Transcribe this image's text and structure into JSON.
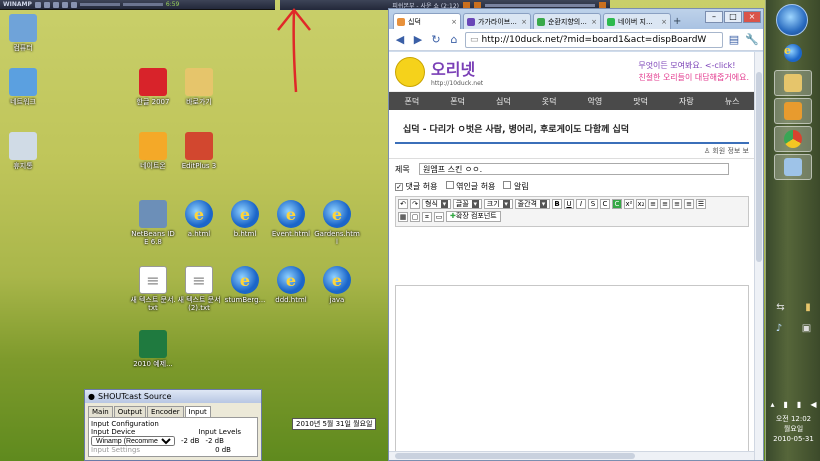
{
  "winamp": {
    "app_label": "WINAMP",
    "time": "6:59",
    "track_title": "피쉬본부 - 사운 쇼 (2:12)"
  },
  "desktop": {
    "icons": [
      {
        "label": "컴퓨터",
        "type": "computer"
      },
      {
        "label": "네트워크",
        "type": "network"
      },
      {
        "label": "휴지통",
        "type": "recycle"
      },
      {
        "label": "한글 2007",
        "type": "hangul"
      },
      {
        "label": "바로가기",
        "type": "folder"
      },
      {
        "label": "네이트온",
        "type": "nateon"
      },
      {
        "label": "EditPlus 3",
        "type": "editplus"
      },
      {
        "label": "NetBeans IDE 6.8",
        "type": "netbeans"
      },
      {
        "label": "a.html",
        "type": "ie"
      },
      {
        "label": "b.html",
        "type": "ie"
      },
      {
        "label": "Event.html",
        "type": "ie"
      },
      {
        "label": "Gardens.html",
        "type": "ie"
      },
      {
        "label": "새 텍스트 문서.txt",
        "type": "txt"
      },
      {
        "label": "새 텍스트 문서 (2).txt",
        "type": "txt"
      },
      {
        "label": "stumBerg...",
        "type": "ie"
      },
      {
        "label": "ddd.html",
        "type": "ie"
      },
      {
        "label": "java",
        "type": "ie"
      },
      {
        "label": "2010 예제...",
        "type": "excel"
      }
    ]
  },
  "shoutcast": {
    "title": "SHOUTcast Source",
    "tabs": [
      "Main",
      "Output",
      "Encoder",
      "Input"
    ],
    "active_tab": "Input",
    "section": "Input Configuration",
    "device_label": "Input Device",
    "device_value": "Winamp (Recommendec",
    "levels_label": "Input Levels",
    "level_left": "-2 dB",
    "level_right": "-2 dB",
    "level_mid": "0 dB",
    "settings_label": "Input Settings"
  },
  "browser": {
    "tabs": [
      {
        "label": "십덕",
        "color": "#e8913b"
      },
      {
        "label": "가가라이브...",
        "color": "#6a47b8"
      },
      {
        "label": "순환지향의...",
        "color": "#39a94a"
      },
      {
        "label": "네이버 지...",
        "color": "#2dba4e"
      }
    ],
    "new_tab": "+",
    "url": "http://10duck.net/?mid=board1&act=dispBoardW",
    "site": {
      "logo": "오리넷",
      "logo_url": "http://10duck.net",
      "slogan_line1": "무엇이든 모여봐요. <-click!",
      "slogan_line2": "친절한 오리들이 대답해줍거에요.",
      "nav": [
        "폰덕",
        "폰덕",
        "십덕",
        "옷덕",
        "악영",
        "맛덕",
        "자랑",
        "뉴스"
      ],
      "board_title": "십덕 - 다리가 ㅇ벗은 사람, 병어리, 후로게이도 다함께 십덕",
      "user_info": "회원 정보 보",
      "subject_label": "제목",
      "subject_value": "원엠프 스킨 ㅇㅇ.",
      "checkboxes": [
        {
          "label": "댓글 허용",
          "checked": true
        },
        {
          "label": "엮인글 허용",
          "checked": false
        },
        {
          "label": "알림",
          "checked": false
        }
      ],
      "dropdowns": [
        "형식",
        "글꼴",
        "크기",
        "줄간격"
      ],
      "insert_component": "확장 컴포넌트",
      "date_tooltip": "2010년 5월 31일 월요일"
    }
  },
  "taskbar": {
    "clock_ampm": "오전 12:02",
    "clock_day": "월요일",
    "clock_date": "2010-05-31"
  }
}
